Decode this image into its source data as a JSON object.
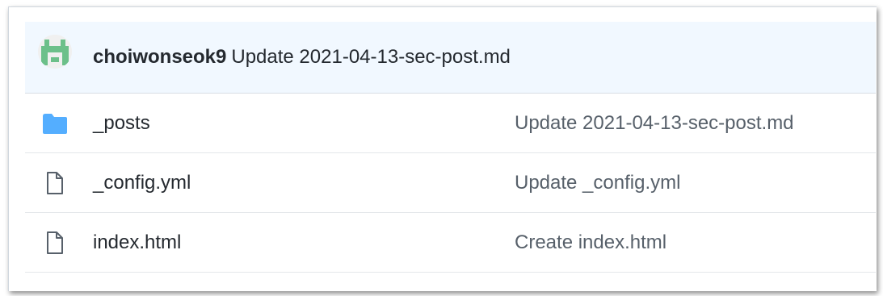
{
  "latest_commit": {
    "author": "choiwonseok9",
    "message": "Update 2021-04-13-sec-post.md",
    "avatar_icon": "identicon-avatar",
    "avatar_color": "#6cc08a"
  },
  "files": [
    {
      "name": "_posts",
      "type": "folder",
      "icon": "folder-icon",
      "commit_message": "Update 2021-04-13-sec-post.md"
    },
    {
      "name": "_config.yml",
      "type": "file",
      "icon": "file-icon",
      "commit_message": "Update _config.yml"
    },
    {
      "name": "index.html",
      "type": "file",
      "icon": "file-icon",
      "commit_message": "Create index.html"
    }
  ],
  "colors": {
    "header_bg": "#f1f8ff",
    "folder": "#54aeff",
    "file": "#57606a"
  }
}
